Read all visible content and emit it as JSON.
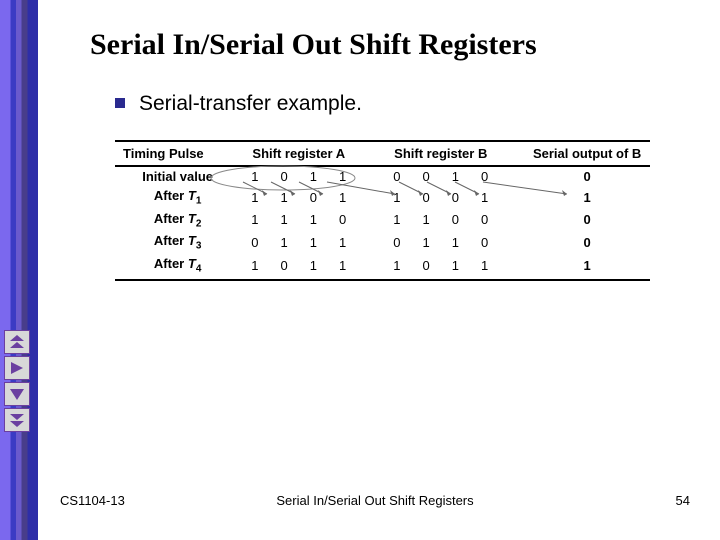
{
  "title": "Serial In/Serial Out Shift Registers",
  "bullet": "Serial-transfer example.",
  "table": {
    "headers": {
      "c0": "Timing Pulse",
      "c1": "Shift register A",
      "c2": "Shift register B",
      "c3": "Serial output of B"
    },
    "rows": [
      {
        "label": "Initial value",
        "a": [
          1,
          0,
          1,
          1
        ],
        "b": [
          0,
          0,
          1,
          0
        ],
        "out": 0
      },
      {
        "label_prefix": "After ",
        "t": "T",
        "tsub": "1",
        "a": [
          1,
          1,
          0,
          1
        ],
        "b": [
          1,
          0,
          0,
          1
        ],
        "out": 1
      },
      {
        "label_prefix": "After ",
        "t": "T",
        "tsub": "2",
        "a": [
          1,
          1,
          1,
          0
        ],
        "b": [
          1,
          1,
          0,
          0
        ],
        "out": 0
      },
      {
        "label_prefix": "After ",
        "t": "T",
        "tsub": "3",
        "a": [
          0,
          1,
          1,
          1
        ],
        "b": [
          0,
          1,
          1,
          0
        ],
        "out": 0
      },
      {
        "label_prefix": "After ",
        "t": "T",
        "tsub": "4",
        "a": [
          1,
          0,
          1,
          1
        ],
        "b": [
          1,
          0,
          1,
          1
        ],
        "out": 1
      }
    ]
  },
  "footer": {
    "left": "CS1104-13",
    "center": "Serial In/Serial Out Shift Registers",
    "right": "54"
  },
  "nav": {
    "first": "first-slide",
    "prev": "prev-slide",
    "next": "next-slide",
    "last": "last-slide"
  },
  "colors": {
    "accent": "#6b3fa0",
    "bullet": "#2a2a8f"
  }
}
